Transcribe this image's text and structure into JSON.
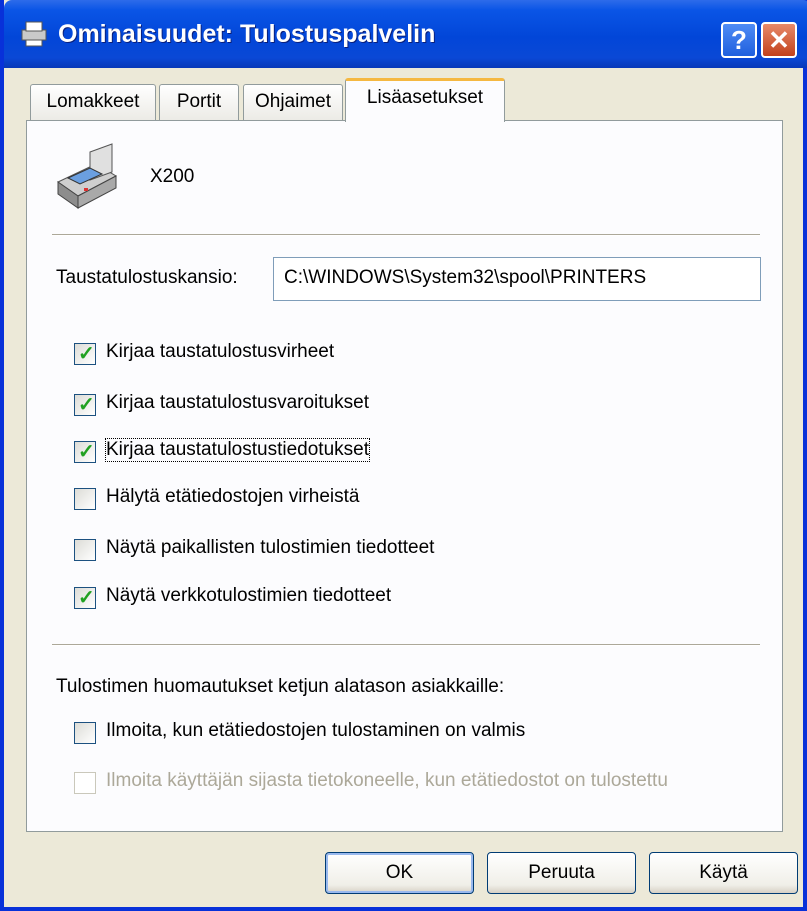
{
  "window": {
    "title": "Ominaisuudet: Tulostuspalvelin",
    "help_button": "?",
    "close_button": "✕"
  },
  "tabs": [
    {
      "label": "Lomakkeet",
      "active": false
    },
    {
      "label": "Portit",
      "active": false
    },
    {
      "label": "Ohjaimet",
      "active": false
    },
    {
      "label": "Lisäasetukset",
      "active": true
    }
  ],
  "printer": {
    "name": "X200",
    "icon": "printer-icon"
  },
  "spool_folder": {
    "label": "Taustatulostuskansio:",
    "value": "C:\\WINDOWS\\System32\\spool\\PRINTERS"
  },
  "options": [
    {
      "label": "Kirjaa taustatulostusvirheet",
      "checked": true,
      "enabled": true
    },
    {
      "label": "Kirjaa taustatulostusvaroitukset",
      "checked": true,
      "enabled": true
    },
    {
      "label": "Kirjaa taustatulostustiedotukset",
      "checked": true,
      "enabled": true
    },
    {
      "label": "Hälytä etätiedostojen virheistä",
      "checked": false,
      "enabled": true
    },
    {
      "label": "Näytä paikallisten tulostimien tiedotteet",
      "checked": false,
      "enabled": true
    },
    {
      "label": "Näytä verkkotulostimien tiedotteet",
      "checked": true,
      "enabled": true
    }
  ],
  "downlevel": {
    "heading": "Tulostimen huomautukset ketjun alatason asiakkaille:",
    "options": [
      {
        "label": "Ilmoita, kun etätiedostojen tulostaminen on valmis",
        "checked": false,
        "enabled": true
      },
      {
        "label": "Ilmoita käyttäjän sijasta tietokoneelle, kun etätiedostot on tulostettu",
        "checked": false,
        "enabled": false
      }
    ]
  },
  "buttons": {
    "ok": "OK",
    "cancel": "Peruuta",
    "apply": "Käytä"
  },
  "colors": {
    "titlebar": "#0a55e6",
    "dialog_bg": "#ece9d8",
    "checkmark": "#21a121"
  }
}
